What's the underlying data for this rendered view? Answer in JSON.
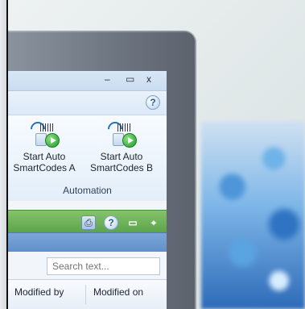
{
  "window": {
    "controls": [
      "–",
      "▭",
      "x"
    ]
  },
  "ribbon": {
    "help_symbol": "?",
    "group": {
      "label": "Automation",
      "buttons": [
        {
          "line1": "Start Auto",
          "line2": "SmartCodes A"
        },
        {
          "line1": "Start Auto",
          "line2": "SmartCodes B"
        }
      ]
    }
  },
  "toolbar": {
    "icons": [
      "printer-icon",
      "help-icon",
      "minimize-box-icon",
      "pin-icon"
    ],
    "help_symbol": "?"
  },
  "search": {
    "placeholder": "Search text..."
  },
  "table": {
    "headers": [
      "Modified by",
      "Modified on"
    ]
  },
  "colors": {
    "green_bar": "#6db257",
    "blue_band": "#6d9bd2",
    "bezel": "#6c7480"
  }
}
